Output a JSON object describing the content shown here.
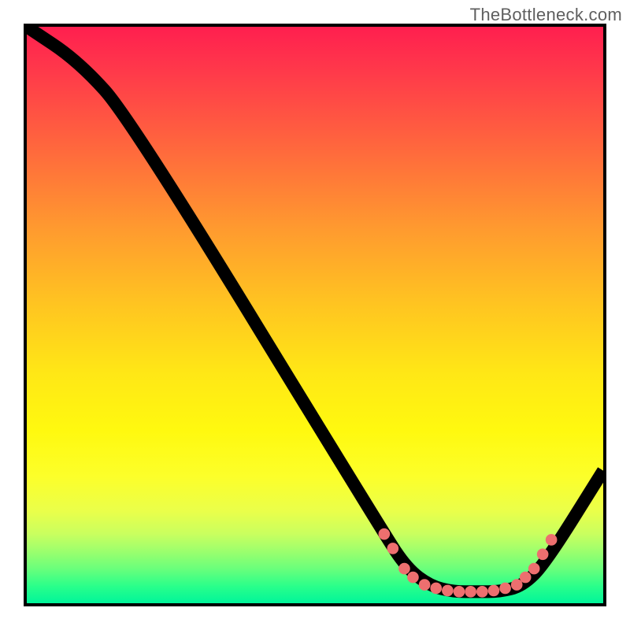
{
  "watermark": "TheBottleneck.com",
  "chart_data": {
    "type": "line",
    "title": "",
    "xlabel": "",
    "ylabel": "",
    "xlim": [
      0,
      100
    ],
    "ylim": [
      0,
      100
    ],
    "grid": false,
    "legend": false,
    "gradient_stops": [
      {
        "pct": 0,
        "color": "#ff1f4f"
      },
      {
        "pct": 8,
        "color": "#ff3a4a"
      },
      {
        "pct": 22,
        "color": "#ff6b3c"
      },
      {
        "pct": 35,
        "color": "#ff9a2f"
      },
      {
        "pct": 48,
        "color": "#ffc421"
      },
      {
        "pct": 60,
        "color": "#ffe716"
      },
      {
        "pct": 70,
        "color": "#fff90f"
      },
      {
        "pct": 78,
        "color": "#fcff2a"
      },
      {
        "pct": 84,
        "color": "#eaff4a"
      },
      {
        "pct": 88,
        "color": "#c9ff5f"
      },
      {
        "pct": 91,
        "color": "#9cff6d"
      },
      {
        "pct": 94,
        "color": "#6aff7b"
      },
      {
        "pct": 97,
        "color": "#2bff8a"
      },
      {
        "pct": 100,
        "color": "#00f59a"
      }
    ],
    "curve_points": [
      {
        "x": 0,
        "y": 100
      },
      {
        "x": 9,
        "y": 94
      },
      {
        "x": 18,
        "y": 84
      },
      {
        "x": 62,
        "y": 12
      },
      {
        "x": 66,
        "y": 6
      },
      {
        "x": 70,
        "y": 3
      },
      {
        "x": 74,
        "y": 2
      },
      {
        "x": 78,
        "y": 2
      },
      {
        "x": 82,
        "y": 2
      },
      {
        "x": 86,
        "y": 3
      },
      {
        "x": 90,
        "y": 7
      },
      {
        "x": 100,
        "y": 23
      }
    ],
    "dot_points": [
      {
        "x": 62.0,
        "y": 12.0
      },
      {
        "x": 63.5,
        "y": 9.5
      },
      {
        "x": 65.5,
        "y": 6.0
      },
      {
        "x": 67.0,
        "y": 4.5
      },
      {
        "x": 69.0,
        "y": 3.2
      },
      {
        "x": 71.0,
        "y": 2.6
      },
      {
        "x": 73.0,
        "y": 2.2
      },
      {
        "x": 75.0,
        "y": 2.0
      },
      {
        "x": 77.0,
        "y": 2.0
      },
      {
        "x": 79.0,
        "y": 2.0
      },
      {
        "x": 81.0,
        "y": 2.2
      },
      {
        "x": 83.0,
        "y": 2.6
      },
      {
        "x": 85.0,
        "y": 3.2
      },
      {
        "x": 86.5,
        "y": 4.5
      },
      {
        "x": 88.0,
        "y": 6.0
      },
      {
        "x": 89.5,
        "y": 8.5
      },
      {
        "x": 91.0,
        "y": 11.0
      }
    ],
    "dot_color": "#ed6f6f",
    "dot_radius_pct": 1.0
  }
}
